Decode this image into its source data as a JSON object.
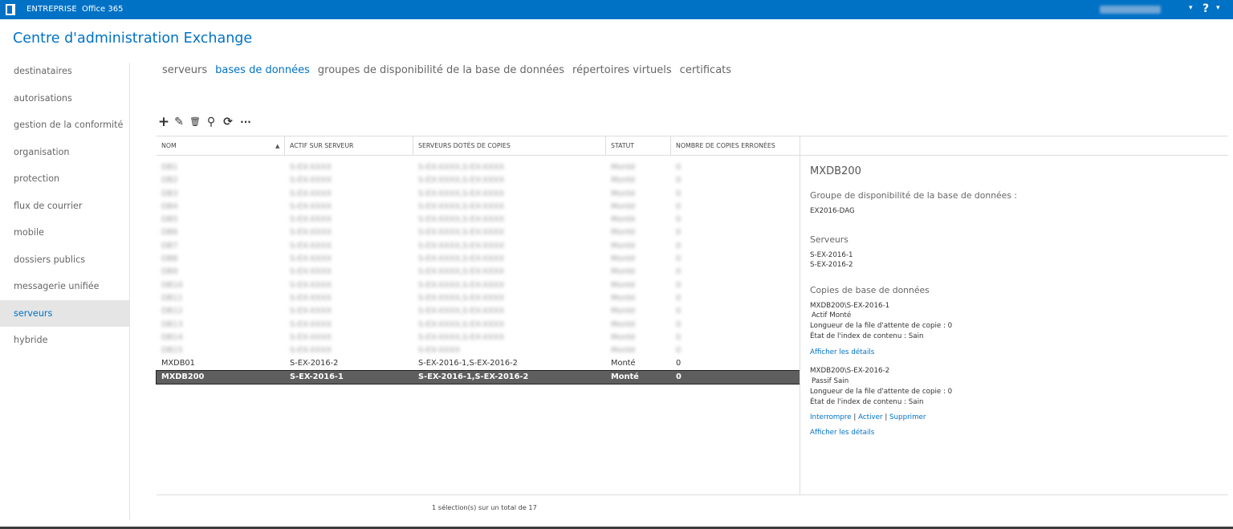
{
  "topbar": {
    "brand": "ENTREPRISE",
    "product": "Office 365",
    "user_caret": "▾",
    "help": "?",
    "help_caret": "▾"
  },
  "app_title": "Centre d'administration Exchange",
  "nav": {
    "items": [
      {
        "label": "destinataires"
      },
      {
        "label": "autorisations"
      },
      {
        "label": "gestion de la conformité"
      },
      {
        "label": "organisation"
      },
      {
        "label": "protection"
      },
      {
        "label": "flux de courrier"
      },
      {
        "label": "mobile"
      },
      {
        "label": "dossiers publics"
      },
      {
        "label": "messagerie unifiée"
      },
      {
        "label": "serveurs",
        "active": true
      },
      {
        "label": "hybride"
      }
    ]
  },
  "tabs": [
    {
      "label": "serveurs"
    },
    {
      "label": "bases de données",
      "active": true
    },
    {
      "label": "groupes de disponibilité de la base de données"
    },
    {
      "label": "répertoires virtuels"
    },
    {
      "label": "certificats"
    }
  ],
  "toolbar": {
    "add_icon": "plus-icon",
    "edit_icon": "pencil-icon",
    "delete_icon": "trash-icon",
    "search_icon": "search-icon",
    "refresh_icon": "refresh-icon",
    "more_icon": "more-icon",
    "add_glyph": "+",
    "edit_glyph": "✎",
    "delete_glyph": "🗑",
    "search_glyph": "⚲",
    "refresh_glyph": "⟳",
    "more_glyph": "···"
  },
  "grid": {
    "columns": [
      "NOM",
      "ACTIF SUR SERVEUR",
      "SERVEURS DOTÉS DE COPIES",
      "STATUT",
      "NOMBRE DE COPIES ERRONÉES"
    ],
    "sort_indicator": "▲",
    "blurred_rows": [
      [
        "DB1",
        "S-EX-XXXX",
        "S-EX-XXXX,S-EX-XXXX",
        "Monté",
        "0"
      ],
      [
        "DB2",
        "S-EX-XXXX",
        "S-EX-XXXX,S-EX-XXXX",
        "Monté",
        "0"
      ],
      [
        "DB3",
        "S-EX-XXXX",
        "S-EX-XXXX,S-EX-XXXX",
        "Monté",
        "0"
      ],
      [
        "DB4",
        "S-EX-XXXX",
        "S-EX-XXXX,S-EX-XXXX",
        "Monté",
        "0"
      ],
      [
        "DB5",
        "S-EX-XXXX",
        "S-EX-XXXX,S-EX-XXXX",
        "Monté",
        "0"
      ],
      [
        "DB6",
        "S-EX-XXXX",
        "S-EX-XXXX,S-EX-XXXX",
        "Monté",
        "0"
      ],
      [
        "DB7",
        "S-EX-XXXX",
        "S-EX-XXXX,S-EX-XXXX",
        "Monté",
        "0"
      ],
      [
        "DB8",
        "S-EX-XXXX",
        "S-EX-XXXX,S-EX-XXXX",
        "Monté",
        "0"
      ],
      [
        "DB9",
        "S-EX-XXXX",
        "S-EX-XXXX,S-EX-XXXX",
        "Monté",
        "0"
      ],
      [
        "DB10",
        "S-EX-XXXX",
        "S-EX-XXXX,S-EX-XXXX",
        "Monté",
        "0"
      ],
      [
        "DB11",
        "S-EX-XXXX",
        "S-EX-XXXX,S-EX-XXXX",
        "Monté",
        "0"
      ],
      [
        "DB12",
        "S-EX-XXXX",
        "S-EX-XXXX,S-EX-XXXX",
        "Monté",
        "0"
      ],
      [
        "DB13",
        "S-EX-XXXX",
        "S-EX-XXXX,S-EX-XXXX",
        "Monté",
        "0"
      ],
      [
        "DB14",
        "S-EX-XXXX",
        "S-EX-XXXX,S-EX-XXXX",
        "Monté",
        "0"
      ],
      [
        "DB15",
        "S-EX-XXXX",
        "S-EX-XXXX",
        "Monté",
        "0"
      ]
    ],
    "rows": [
      [
        "MXDB01",
        "S-EX-2016-2",
        "S-EX-2016-1,S-EX-2016-2",
        "Monté",
        "0"
      ],
      [
        "MXDB200",
        "S-EX-2016-1",
        "S-EX-2016-1,S-EX-2016-2",
        "Monté",
        "0"
      ]
    ],
    "status_text": "1 sélection(s) sur un total de 17"
  },
  "details": {
    "title": "MXDB200",
    "dag_heading": "Groupe de disponibilité de la base de données :",
    "dag_value": "EX2016-DAG",
    "servers_heading": "Serveurs",
    "servers": [
      "S-EX-2016-1",
      "S-EX-2016-2"
    ],
    "copies_heading": "Copies de base de données",
    "copy1": {
      "name": "MXDB200\\S-EX-2016-1",
      "state": "Actif Monté",
      "queue": "Longueur de la file d'attente de copie : 0",
      "index": "État de l'index de contenu : Sain",
      "details_link": "Afficher les détails"
    },
    "copy2": {
      "name": "MXDB200\\S-EX-2016-2",
      "state": "Passif Sain",
      "queue": "Longueur de la file d'attente de copie : 0",
      "index": "État de l'index de contenu : Sain",
      "action_suspend": "Interrompre",
      "action_activate": "Activer",
      "action_remove": "Supprimer",
      "separator": "|",
      "details_link": "Afficher les détails"
    }
  }
}
